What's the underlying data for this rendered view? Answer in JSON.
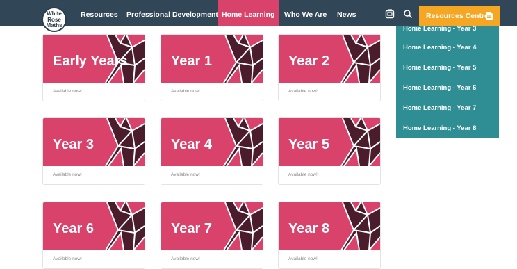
{
  "logo": {
    "line1": "White",
    "line2": "Rose",
    "line3": "Maths"
  },
  "nav": {
    "items": [
      {
        "label": "Resources"
      },
      {
        "label": "Professional Development"
      },
      {
        "label": "Home Learning"
      },
      {
        "label": "Who We Are"
      },
      {
        "label": "News"
      }
    ],
    "active_item": "Home Learning",
    "icons": [
      "library-icon",
      "search-icon",
      "document-icon"
    ],
    "resources_centre_label": "Resources Centre"
  },
  "dropdown": {
    "items": [
      {
        "label": "Home Learning - Year 3"
      },
      {
        "label": "Home Learning - Year 4"
      },
      {
        "label": "Home Learning - Year 5"
      },
      {
        "label": "Home Learning - Year 6"
      },
      {
        "label": "Home Learning - Year 7"
      },
      {
        "label": "Home Learning - Year 8"
      }
    ]
  },
  "cards": [
    {
      "title": "Early Years",
      "status": "Available now!"
    },
    {
      "title": "Year 1",
      "status": "Available now!"
    },
    {
      "title": "Year 2",
      "status": "Available now!"
    },
    {
      "title": "Year 3",
      "status": "Available now!"
    },
    {
      "title": "Year 4",
      "status": "Available now!"
    },
    {
      "title": "Year 5",
      "status": "Available now!"
    },
    {
      "title": "Year 6",
      "status": "Available now!"
    },
    {
      "title": "Year 7",
      "status": "Available now!"
    },
    {
      "title": "Year 8",
      "status": "Available now!"
    }
  ],
  "colors": {
    "nav_bg": "#314657",
    "brand_pink": "#d9426a",
    "accent_orange": "#f5a623",
    "dropdown_teal": "#2f8e93",
    "banner_dark": "#4a1c2c"
  }
}
